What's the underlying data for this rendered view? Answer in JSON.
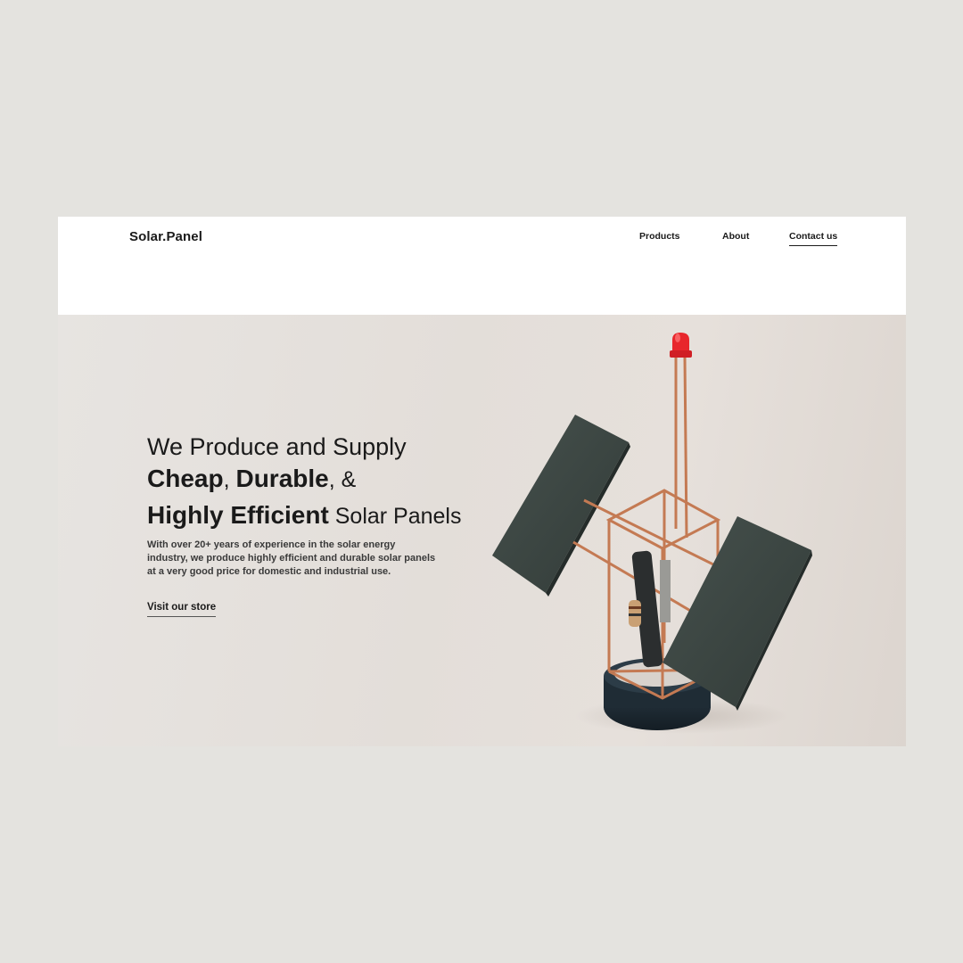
{
  "brand": "Solar.Panel",
  "nav": {
    "products": "Products",
    "about": "About",
    "contact": "Contact us"
  },
  "hero": {
    "line1": "We Produce and Supply",
    "cheap": "Cheap",
    "comma1": ", ",
    "durable": "Durable",
    "comma2": ", &",
    "efficient": "Highly Efficient",
    "panels": " Solar Panels",
    "lead": [
      "With over 20+ years of experience in the solar energy",
      "industry, we produce highly efficient and durable solar panels",
      "at a very good price for domestic and industrial use."
    ],
    "cta": "Visit our store"
  },
  "colors": {
    "page_bg": "#e4e3df",
    "hero_bg": "#e3ded9",
    "panel": "#3a4440",
    "copper": "#c97a55",
    "led": "#e8262c",
    "base": "#1d2a33"
  }
}
